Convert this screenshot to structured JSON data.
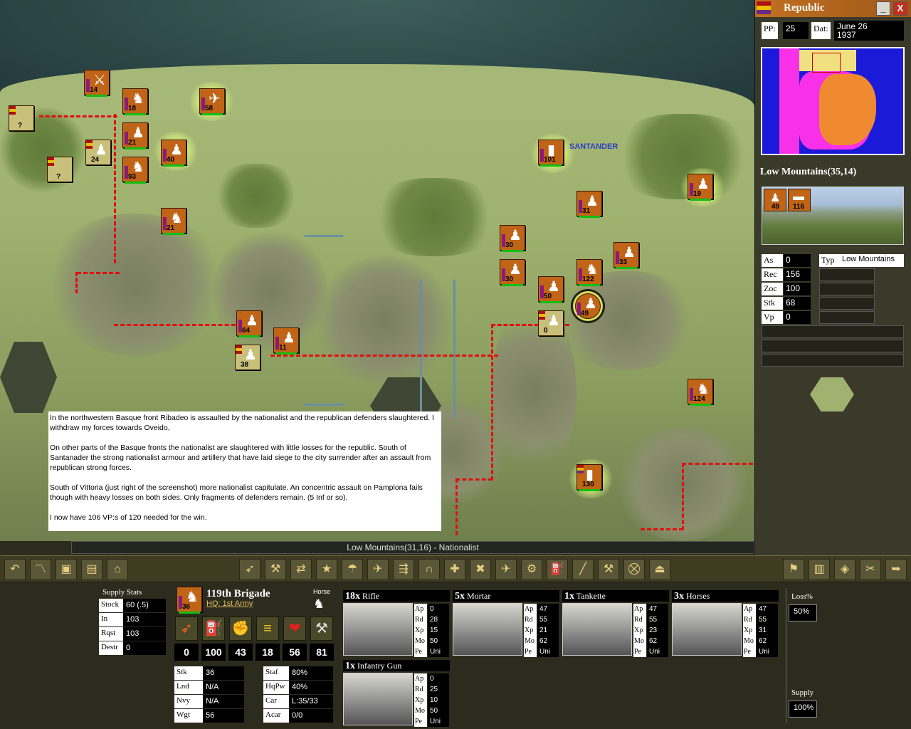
{
  "side_panel": {
    "title": "Republic",
    "minimize": "_",
    "close": "X",
    "pp_label": "PP:",
    "pp_value": "25",
    "date_label": "Dat:",
    "date_value": "June 26\n1937",
    "terrain_title": "Low Mountains(35,14)",
    "terrain_units": [
      {
        "num": "49"
      },
      {
        "num": "116"
      }
    ],
    "stats": [
      {
        "k": "As",
        "v": "0"
      },
      {
        "k": "Rec",
        "v": "156"
      },
      {
        "k": "Zoc",
        "v": "100"
      },
      {
        "k": "Stk",
        "v": "68"
      },
      {
        "k": "Vp",
        "v": "0"
      }
    ],
    "typ_label": "Typ",
    "typ_value": "Low Mountains"
  },
  "map": {
    "city_labels": [
      "SANTANDER"
    ],
    "units": [
      {
        "num": "14"
      },
      {
        "num": "18"
      },
      {
        "num": "58"
      },
      {
        "num": "?"
      },
      {
        "num": "21"
      },
      {
        "num": "40"
      },
      {
        "num": "24"
      },
      {
        "num": "93"
      },
      {
        "num": "?"
      },
      {
        "num": "21"
      },
      {
        "num": "101"
      },
      {
        "num": "19"
      },
      {
        "num": "31"
      },
      {
        "num": "30"
      },
      {
        "num": "30"
      },
      {
        "num": "33"
      },
      {
        "num": "122"
      },
      {
        "num": "50"
      },
      {
        "num": "49"
      },
      {
        "num": "0"
      },
      {
        "num": "64"
      },
      {
        "num": "11"
      },
      {
        "num": "38"
      },
      {
        "num": "124"
      },
      {
        "num": "130"
      }
    ]
  },
  "story": {
    "p1": "In the northwestern Basque front Ribadeo is assaulted by the nationalist and the republican defenders slaughtered. I withdraw my forces towards Oveido,",
    "p2": "On other parts of the Basque fronts the nationalist are slaughtered with little losses for the republic. South of Santanader the strong nationalist armour and artillery that have laid siege to the city surrender after an assault from republican strong forces.",
    "p3": "South of Vittoria (just right of the screenshot) more nationalist capitulate. An concentric assault on Pamplona fails though with heavy losses on both sides. Only fragments of defenders remain. (5 Inf or so).",
    "p4": "I now have 106 VP:s of 120 needed for the win."
  },
  "status_bar": "Low Mountains(31,16) - Nationalist",
  "supply_stats": {
    "title": "Supply Stats",
    "rows": [
      {
        "k": "Stock",
        "v": "60 (.5)"
      },
      {
        "k": "In",
        "v": "103"
      },
      {
        "k": "Rqst",
        "v": "103"
      },
      {
        "k": "Destr",
        "v": "0"
      }
    ]
  },
  "unit_panel": {
    "counter_num": "36",
    "name": "119th Brigade",
    "hq": "HQ: 1st Army",
    "horse_label": "Horse",
    "big_stats": [
      "0",
      "100",
      "43",
      "18",
      "56",
      "81"
    ],
    "stats_left": [
      {
        "k": "Stk",
        "v": "36"
      },
      {
        "k": "Lnd",
        "v": "N/A"
      },
      {
        "k": "Nvy",
        "v": "N/A"
      },
      {
        "k": "Wgt",
        "v": "56"
      }
    ],
    "stats_right": [
      {
        "k": "Staf",
        "v": "80%"
      },
      {
        "k": "HqPw",
        "v": "40%"
      },
      {
        "k": "Car",
        "v": "L:35/33"
      },
      {
        "k": "Acar",
        "v": "0/0"
      }
    ]
  },
  "equipment": [
    {
      "count": "18x",
      "name": "Rifle",
      "ap": "0",
      "rd": "28",
      "xp": "15",
      "mo": "50",
      "pe": "Uni"
    },
    {
      "count": "5x",
      "name": "Mortar",
      "ap": "47",
      "rd": "55",
      "xp": "21",
      "mo": "62",
      "pe": "Uni"
    },
    {
      "count": "1x",
      "name": "Tankette",
      "ap": "47",
      "rd": "55",
      "xp": "23",
      "mo": "62",
      "pe": "Uni"
    },
    {
      "count": "3x",
      "name": "Horses",
      "ap": "47",
      "rd": "55",
      "xp": "31",
      "mo": "62",
      "pe": "Uni"
    },
    {
      "count": "1x",
      "name": "Infantry Gun",
      "ap": "0",
      "rd": "25",
      "xp": "10",
      "mo": "50",
      "pe": "Uni"
    }
  ],
  "eq_keys": {
    "ap": "Ap",
    "rd": "Rd",
    "xp": "Xp",
    "mo": "Mo",
    "pe": "Pe"
  },
  "loss": {
    "label": "Loss%",
    "value": "50%"
  },
  "supply": {
    "label": "Supply",
    "value": "100%"
  },
  "colors": {
    "rep_orange": "#c06418",
    "front_red": "#e01010",
    "nationalist_tan": "#c8c07a"
  }
}
